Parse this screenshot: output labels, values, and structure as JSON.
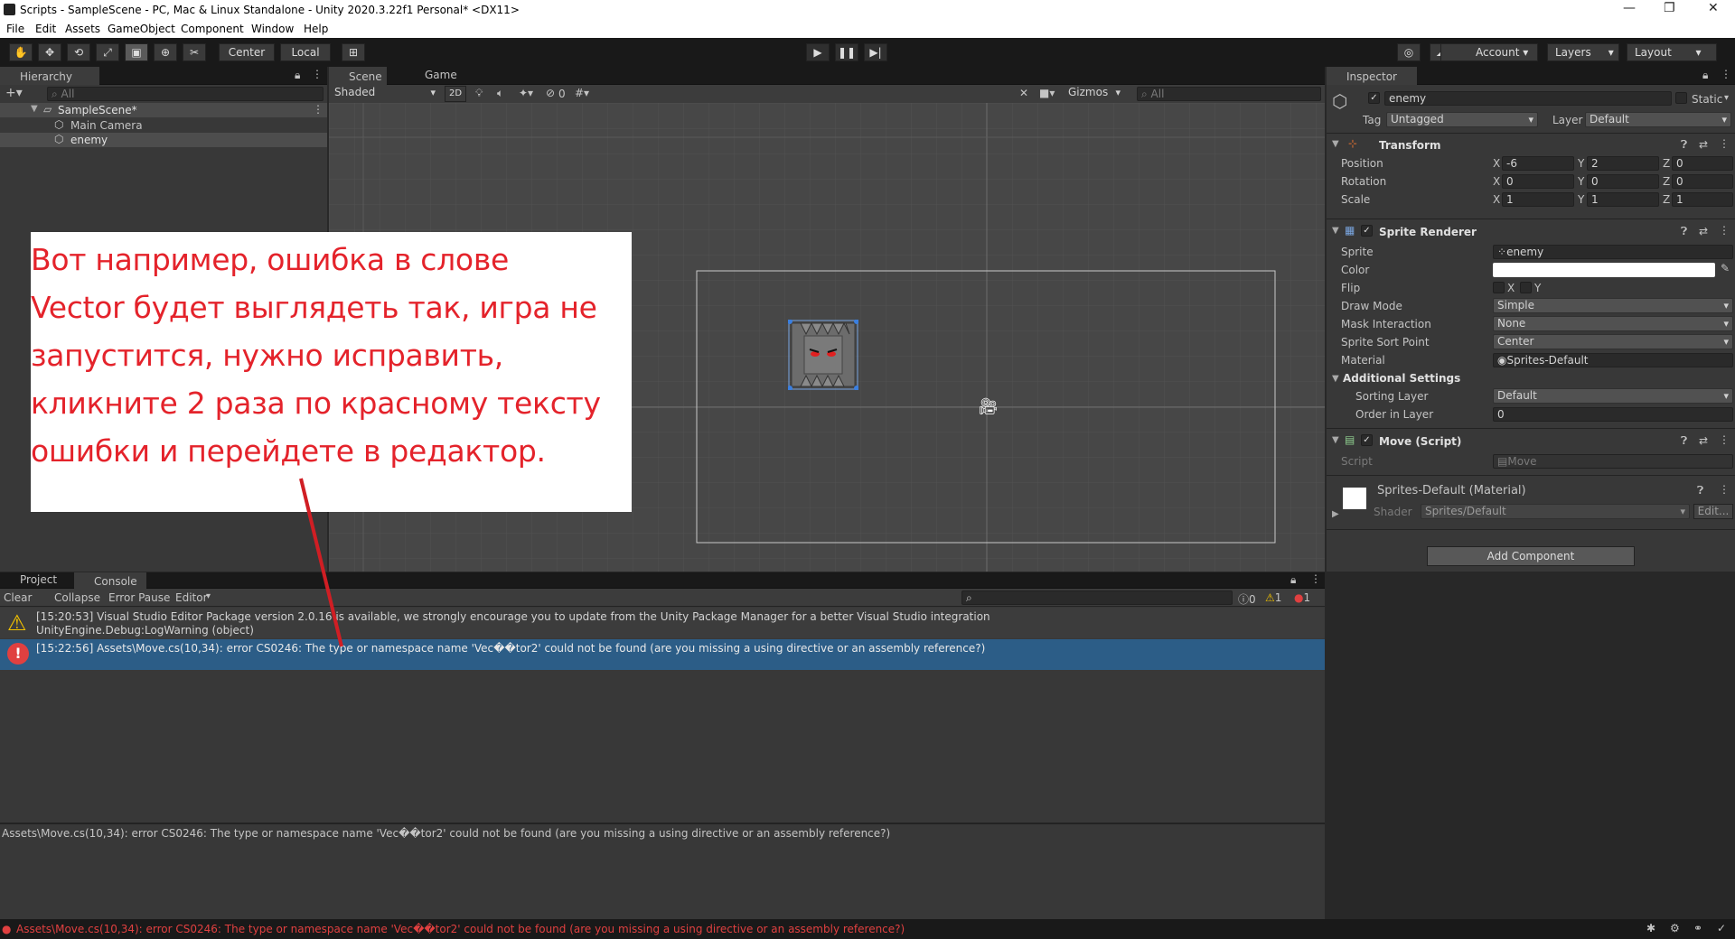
{
  "window": {
    "title": "Scripts - SampleScene - PC, Mac & Linux Standalone - Unity 2020.3.22f1 Personal* <DX11>"
  },
  "menu": [
    "File",
    "Edit",
    "Assets",
    "GameObject",
    "Component",
    "Window",
    "Help"
  ],
  "toolbar": {
    "center": "Center",
    "local": "Local",
    "account": "Account",
    "layers": "Layers",
    "layout": "Layout"
  },
  "hierarchy": {
    "tab": "Hierarchy",
    "search_placeholder": "All",
    "scene": "SampleScene*",
    "items": [
      "Main Camera",
      "enemy"
    ]
  },
  "scene_view": {
    "tabs": [
      "Scene",
      "Game"
    ],
    "shading": "Shaded",
    "mode_2d": "2D",
    "hidden_count": "0",
    "gizmos": "Gizmos",
    "search_placeholder": "All"
  },
  "annotation": {
    "lines": [
      "Вот например, ошибка в слове",
      "Vector  будет выглядеть так, игра не",
      "запустится, нужно исправить,",
      "кликните 2 раза по красному тексту",
      "ошибки и перейдете в редактор."
    ],
    "color": "#e4232b"
  },
  "inspector": {
    "tab": "Inspector",
    "object_name": "enemy",
    "static": "Static",
    "tag_label": "Tag",
    "tag": "Untagged",
    "layer_label": "Layer",
    "layer": "Default",
    "transform": {
      "title": "Transform",
      "rows": [
        {
          "label": "Position",
          "x": "-6",
          "y": "2",
          "z": "0"
        },
        {
          "label": "Rotation",
          "x": "0",
          "y": "0",
          "z": "0"
        },
        {
          "label": "Scale",
          "x": "1",
          "y": "1",
          "z": "1"
        }
      ],
      "axes": [
        "X",
        "Y",
        "Z"
      ]
    },
    "sprite_renderer": {
      "title": "Sprite Renderer",
      "sprite_label": "Sprite",
      "sprite": "enemy",
      "color_label": "Color",
      "flip_label": "Flip",
      "flip_x": "X",
      "flip_y": "Y",
      "draw_mode_label": "Draw Mode",
      "draw_mode": "Simple",
      "mask_label": "Mask Interaction",
      "mask": "None",
      "sort_point_label": "Sprite Sort Point",
      "sort_point": "Center",
      "material_label": "Material",
      "material": "Sprites-Default",
      "additional": "Additional Settings",
      "sorting_layer_label": "Sorting Layer",
      "sorting_layer": "Default",
      "order_label": "Order in Layer",
      "order": "0"
    },
    "move_script": {
      "title": "Move (Script)",
      "script_label": "Script",
      "script": "Move"
    },
    "material": {
      "title": "Sprites-Default (Material)",
      "shader_label": "Shader",
      "shader": "Sprites/Default",
      "edit": "Edit..."
    },
    "add_component": "Add Component"
  },
  "console": {
    "tabs": [
      "Project",
      "Console"
    ],
    "clear": "Clear",
    "collapse": "Collapse",
    "error_pause": "Error Pause",
    "editor": "Editor",
    "counts": {
      "log": "0",
      "warn": "1",
      "error": "1"
    },
    "entries": [
      {
        "line1": "[15:20:53] Visual Studio Editor Package version 2.0.16 is available, we strongly encourage you to update from the Unity Package Manager for a better Visual Studio integration",
        "line2": "UnityEngine.Debug:LogWarning (object)"
      },
      {
        "line1": "[15:22:56] Assets\\Move.cs(10,34): error CS0246: The type or namespace name 'Vec��tor2' could not be found (are you missing a using directive or an assembly reference?)"
      }
    ],
    "detail": "Assets\\Move.cs(10,34): error CS0246: The type or namespace name 'Vec��tor2' could not be found (are you missing a using directive or an assembly reference?)"
  },
  "status_bar": {
    "message": "Assets\\Move.cs(10,34): error CS0246: The type or namespace name 'Vec��tor2' could not be found (are you missing a using directive or an assembly reference?)"
  }
}
